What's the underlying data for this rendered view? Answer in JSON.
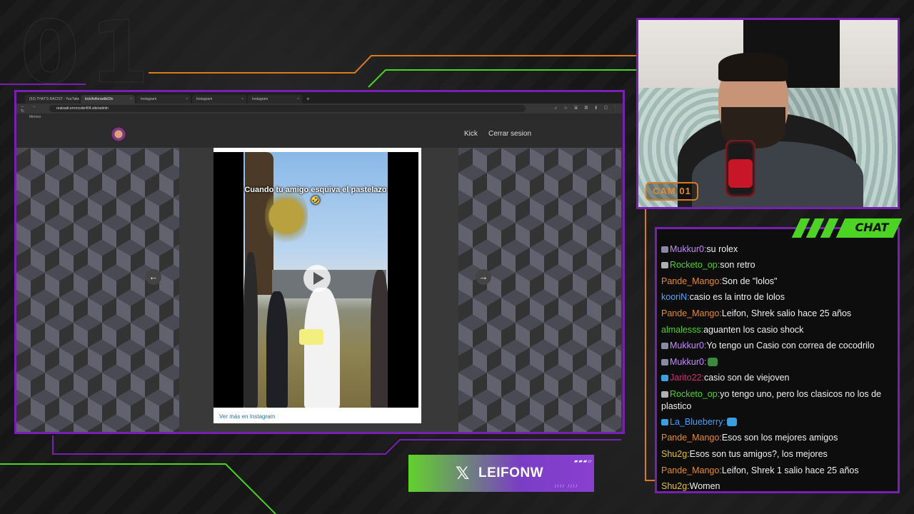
{
  "overlay": {
    "big_number": "01",
    "accent_purple": "#7a1fb3",
    "accent_green": "#4cd422",
    "accent_orange": "#d87a1e"
  },
  "browser": {
    "tabs": [
      {
        "label": "(53) THAT'S RACIST - YouTube",
        "active": false
      },
      {
        "label": "kick/leifonwdb03n",
        "active": true
      },
      {
        "label": "Instagram",
        "active": false
      },
      {
        "label": "Instagram",
        "active": false
      },
      {
        "label": "Instagram",
        "active": false
      }
    ],
    "new_tab": "+",
    "nav_icons": "← → ↻",
    "address": "realsadi.errorcode404.site/admin",
    "ext_icons": "⌕ ☆ ▣ ▤ ⬇ ▢ ⋮",
    "bookmark": "Memes"
  },
  "site": {
    "nav_kick": "Kick",
    "nav_logout": "Cerrar sesion",
    "prev_arrow": "←",
    "next_arrow": "→",
    "video_caption": "Cuando tu amigo esquiva el pastelazo 🤣",
    "instagram_link": "Ver más en Instagram"
  },
  "cam": {
    "label": "CAM 01"
  },
  "chat": {
    "title": "CHAT",
    "messages": [
      {
        "user": "Mukkur0",
        "color": "#c58bff",
        "badge": "#8a8aa8",
        "text": "su rolex",
        "emote": null
      },
      {
        "user": "Rocketo_op",
        "color": "#4cd422",
        "badge": "#b0b0b0",
        "text": "son retro",
        "emote": null
      },
      {
        "user": "Pande_Mango",
        "color": "#e68a2c",
        "badge": null,
        "text": "Son de \"lolos\"",
        "emote": null
      },
      {
        "user": "kooriN",
        "color": "#4fa7ff",
        "badge": null,
        "text": "casio es la intro de lolos",
        "emote": null
      },
      {
        "user": "Pande_Mango",
        "color": "#e68a2c",
        "badge": null,
        "text": "Leifon, Shrek salio hace 25 años",
        "emote": null
      },
      {
        "user": "almalesss",
        "color": "#4cd422",
        "badge": null,
        "text": "aguanten los casio shock",
        "emote": null
      },
      {
        "user": "Mukkur0",
        "color": "#c58bff",
        "badge": "#8a8aa8",
        "text": "Yo tengo un Casio con correa de cocodrilo",
        "emote": null
      },
      {
        "user": "Mukkur0",
        "color": "#c58bff",
        "badge": "#8a8aa8",
        "text": "",
        "emote": "#3a8a3a"
      },
      {
        "user": "Jarito22",
        "color": "#d03070",
        "badge": "#3aa0e0",
        "text": "casio son de viejoven",
        "emote": null
      },
      {
        "user": "Rocketo_op",
        "color": "#4cd422",
        "badge": "#b0b0b0",
        "text": "yo tengo uno, pero los clasicos no los de plastico",
        "emote": null
      },
      {
        "user": "La_Blueberry",
        "color": "#3aa0ff",
        "badge": "#3aa0e0",
        "text": "",
        "emote": "#3aa0e0"
      },
      {
        "user": "Pande_Mango",
        "color": "#e68a2c",
        "badge": null,
        "text": "Esos son los mejores amigos",
        "emote": null
      },
      {
        "user": "Shu2g",
        "color": "#e6c22c",
        "badge": null,
        "text": "Esos son tus amigos?, los mejores",
        "emote": null
      },
      {
        "user": "Pande_Mango",
        "color": "#e68a2c",
        "badge": null,
        "text": "Leifon, Shrek 1 salio hace 25 años",
        "emote": null
      },
      {
        "user": "Shu2g",
        "color": "#e6c22c",
        "badge": null,
        "text": "Women",
        "emote": null
      }
    ]
  },
  "social": {
    "x_icon": "𝕏",
    "handle": "LEIFONW",
    "deco_top": "▰▰▰▱",
    "deco_bottom": "//// ////"
  }
}
